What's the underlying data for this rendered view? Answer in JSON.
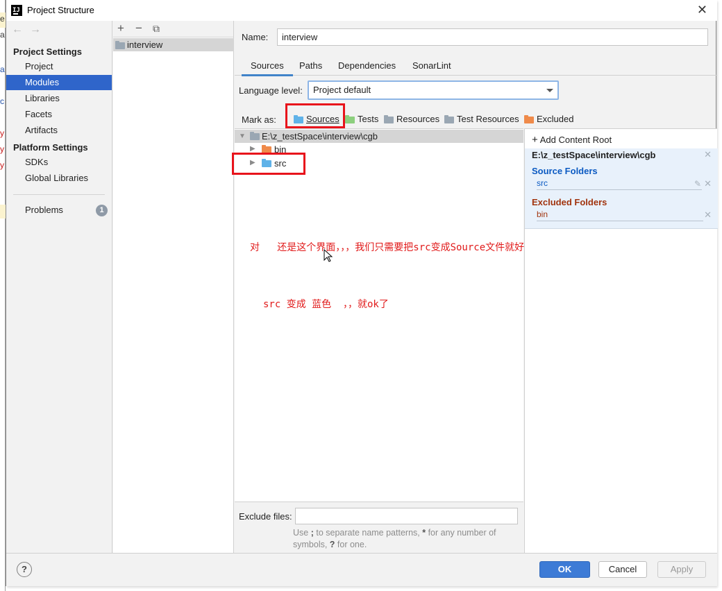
{
  "window": {
    "title": "Project Structure"
  },
  "nav": {
    "project_settings": "Project Settings",
    "project_items": [
      "Project",
      "Modules",
      "Libraries",
      "Facets",
      "Artifacts"
    ],
    "platform_settings": "Platform Settings",
    "platform_items": [
      "SDKs",
      "Global Libraries"
    ],
    "problems": "Problems",
    "problems_count": "1"
  },
  "modules": {
    "items": [
      "interview"
    ]
  },
  "detail": {
    "name_label": "Name:",
    "name_value": "interview",
    "tabs": [
      "Sources",
      "Paths",
      "Dependencies",
      "SonarLint"
    ],
    "language_level_label": "Language level:",
    "language_level_value": "Project default",
    "mark_as_label": "Mark as:",
    "mark_as": [
      "Sources",
      "Tests",
      "Resources",
      "Test Resources",
      "Excluded"
    ],
    "tree": {
      "root": "E:\\z_testSpace\\interview\\cgb",
      "children": [
        "bin",
        "src"
      ]
    },
    "annotation_1": "对   还是这个界面，，，我们只需要把src变成Source文件就好了",
    "annotation_2": "src 变成 蓝色  ，，就ok了",
    "exclude_label": "Exclude files:",
    "exclude_hint_1": "Use ",
    "exclude_hint_sep": ";",
    "exclude_hint_2": " to separate name patterns, ",
    "exclude_hint_star": "*",
    "exclude_hint_3": " for any number of symbols, ",
    "exclude_hint_q": "?",
    "exclude_hint_4": " for one."
  },
  "content_roots": {
    "add_label": "Add Content Root",
    "path": "E:\\z_testSpace\\interview\\cgb",
    "source_header": "Source Folders",
    "source_entry": "src",
    "excluded_header": "Excluded Folders",
    "excluded_entry": "bin"
  },
  "footer": {
    "help": "?",
    "ok": "OK",
    "cancel": "Cancel",
    "apply": "Apply"
  },
  "colors": {
    "selection": "#2f65ca",
    "source_folder": "#5fb2e8",
    "test_folder": "#8ccf7e",
    "excluded_folder": "#ef8a4a",
    "source_header": "#0b5ac2",
    "excluded_header": "#a1340e",
    "annotation": "#e11a1a",
    "highlight_box": "#e8131b"
  }
}
